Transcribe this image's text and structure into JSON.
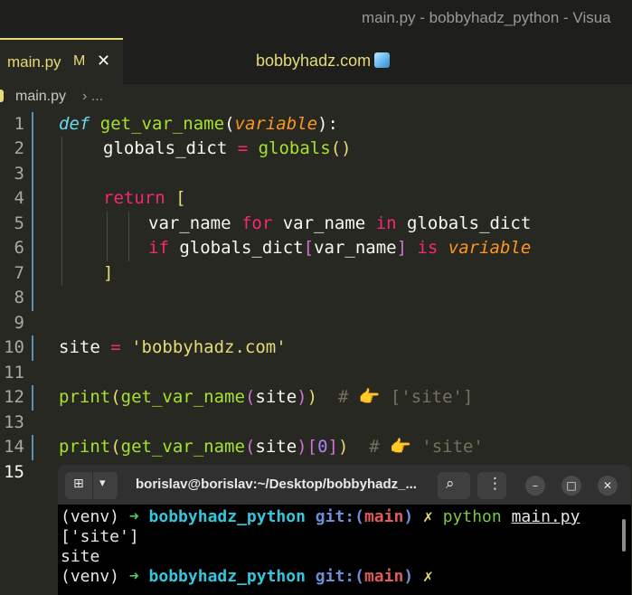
{
  "window": {
    "title": "main.py - bobbyhadz_python - Visua"
  },
  "tab": {
    "name": "main.py",
    "modified": "M",
    "close": "✕"
  },
  "brand": {
    "text": "bobbyhadz.com"
  },
  "breadcrumb": {
    "file": "main.py",
    "rest": "› ..."
  },
  "code": {
    "line_numbers": [
      "1",
      "2",
      "3",
      "4",
      "5",
      "6",
      "7",
      "8",
      "9",
      "10",
      "11",
      "12",
      "13",
      "14",
      "15"
    ],
    "current_line": "15",
    "l1": {
      "kw": "def",
      "fn": "get_var_name",
      "p1": "(",
      "param": "variable",
      "p2": ")",
      "colon": ":"
    },
    "l2": {
      "var": "globals_dict",
      "eq": " = ",
      "fn": "globals",
      "paren": "()"
    },
    "l4": {
      "kw": "return",
      "br": "["
    },
    "l5": {
      "a": "var_name ",
      "kw1": "for",
      "b": " var_name ",
      "kw2": "in",
      "c": " globals_dict"
    },
    "l6": {
      "kw": "if",
      "a": " globals_dict",
      "b1": "[",
      "b": "var_name",
      "b2": "]",
      "kw2": " is ",
      "var": "variable"
    },
    "l7": {
      "br": "]"
    },
    "l10": {
      "a": "site",
      "eq": " = ",
      "str": "'bobbyhadz.com'"
    },
    "l12": {
      "fn": "print",
      "p1": "(",
      "fn2": "get_var_name",
      "p2": "(",
      "arg": "site",
      "p3": ")",
      "p4": ")",
      "com": "  # 👉 ['site']"
    },
    "l14": {
      "fn": "print",
      "p1": "(",
      "fn2": "get_var_name",
      "p2": "(",
      "arg": "site",
      "p3": ")",
      "b1": "[",
      "num": "0",
      "b2": "]",
      "p4": ")",
      "com": "  # 👉 'site'"
    }
  },
  "terminal": {
    "title": "borislav@borislav:~/Desktop/bobbyhadz_...",
    "new_tab_icon": "⊞",
    "dropdown_icon": "▾",
    "search_icon": "⌕",
    "menu_icon": "⋮",
    "minimize": "–",
    "maximize": "□",
    "close": "✕",
    "l1": {
      "venv": "(venv) ",
      "arrow": "➜ ",
      "dir": "bobbyhadz_python",
      "git": " git:(",
      "branch": "main",
      "git2": ")",
      "x": " ✗",
      "cmd": " python",
      "sp": " ",
      "file": "main.py"
    },
    "l2": "['site']",
    "l3": "site",
    "l4": {
      "venv": "(venv) ",
      "arrow": "➜ ",
      "dir": "bobbyhadz_python",
      "git": " git:(",
      "branch": "main",
      "git2": ")",
      "x": " ✗"
    }
  }
}
